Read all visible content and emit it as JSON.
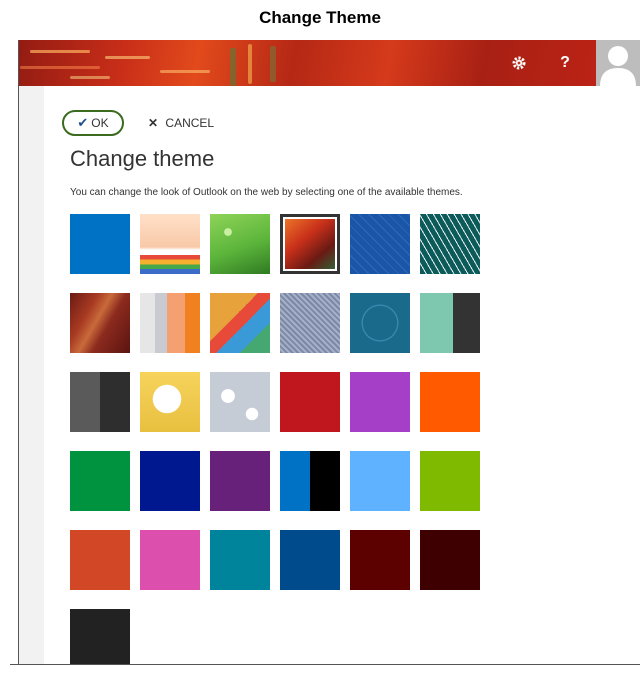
{
  "caption": "Change Theme",
  "header": {
    "settings_icon": "gear-icon",
    "help_label": "?",
    "avatar_icon": "person-icon"
  },
  "dialog": {
    "ok_label": "OK",
    "cancel_label": "CANCEL",
    "title": "Change theme",
    "description": "You can change the look of Outlook on the web by selecting one of the available themes."
  },
  "themes": [
    {
      "color": "#0072c6",
      "kind": "solid"
    },
    {
      "color": "#f8c9a8",
      "kind": "stars"
    },
    {
      "color": "#5cb53b",
      "kind": "grass"
    },
    {
      "color": "#c8301a",
      "kind": "abstract",
      "selected": true
    },
    {
      "color": "#1a55a8",
      "kind": "blueprint"
    },
    {
      "color": "#0d5a5a",
      "kind": "circuit"
    },
    {
      "color": "#8c2a1e",
      "kind": "wood"
    },
    {
      "color": "#f4a070",
      "kind": "stripes"
    },
    {
      "color": "#e8a23c",
      "kind": "geometric"
    },
    {
      "color": "#7c88a6",
      "kind": "heart"
    },
    {
      "color": "#1a6a8c",
      "kind": "circles"
    },
    {
      "color": "#7fc8b0",
      "kind": "split"
    },
    {
      "color": "#555555",
      "kind": "darksplit"
    },
    {
      "color": "#f7d35c",
      "kind": "cat"
    },
    {
      "color": "#c5ccd6",
      "kind": "snow"
    },
    {
      "color": "#c0161d",
      "kind": "solid"
    },
    {
      "color": "#a53fc8",
      "kind": "solid"
    },
    {
      "color": "#ff5a00",
      "kind": "solid"
    },
    {
      "color": "#00933f",
      "kind": "solid"
    },
    {
      "color": "#00188f",
      "kind": "solid"
    },
    {
      "color": "#68217a",
      "kind": "solid"
    },
    {
      "color": "#0072c6",
      "kind": "blackblue"
    },
    {
      "color": "#5eb2ff",
      "kind": "solid"
    },
    {
      "color": "#7fba00",
      "kind": "solid"
    },
    {
      "color": "#d24726",
      "kind": "solid"
    },
    {
      "color": "#dc4fad",
      "kind": "solid"
    },
    {
      "color": "#00849b",
      "kind": "solid"
    },
    {
      "color": "#004b8c",
      "kind": "solid"
    },
    {
      "color": "#5c0000",
      "kind": "solid"
    },
    {
      "color": "#3e0000",
      "kind": "solid"
    },
    {
      "color": "#222222",
      "kind": "solid"
    }
  ]
}
